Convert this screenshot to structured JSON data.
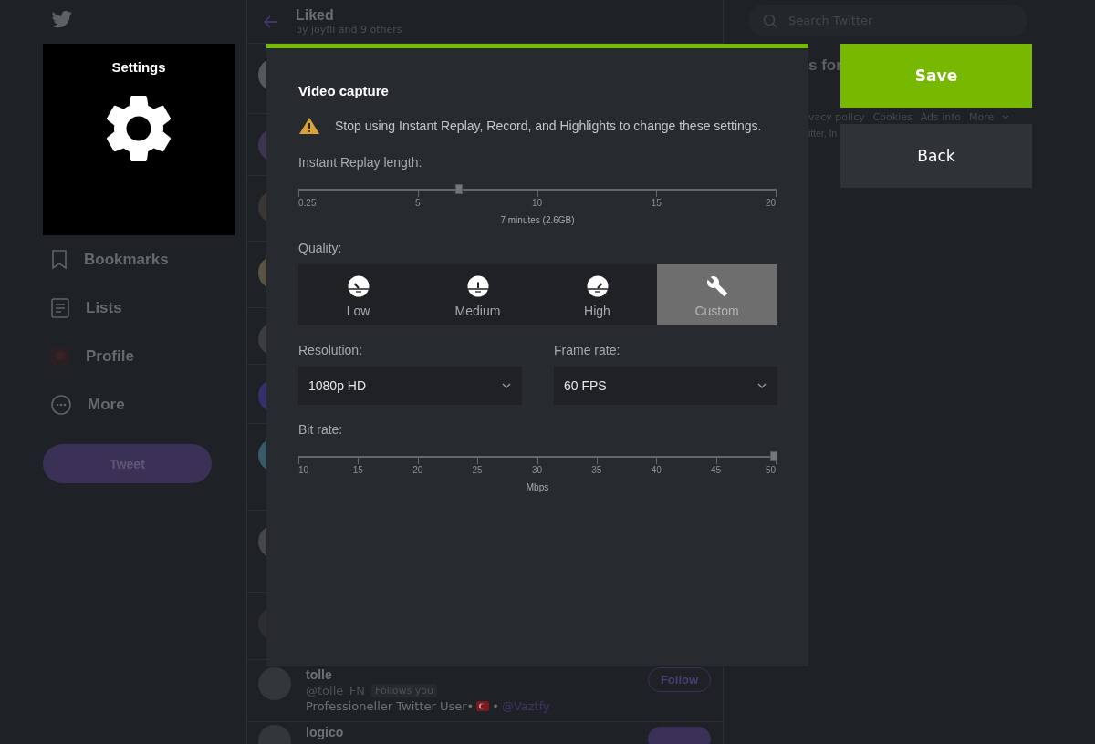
{
  "sidebar": {
    "items": [
      {
        "label": "Bookmarks",
        "kind": "bookmark"
      },
      {
        "label": "Lists",
        "kind": "list"
      },
      {
        "label": "Profile",
        "kind": "profile"
      },
      {
        "label": "More",
        "kind": "more"
      }
    ],
    "tweet_button": "Tweet"
  },
  "settings_tile": {
    "title": "Settings"
  },
  "timeline": {
    "title": "Liked",
    "subtitle": "by joyfll and 9 others",
    "users": [
      {
        "name": "tolle",
        "handle": "@tolle_FN",
        "badge": "Follows you",
        "bio": "Professioneller Twitter User•",
        "bio_after_flag": "•",
        "mention": "@Vaztfy",
        "button": "Follow",
        "following": false
      },
      {
        "name": "logico",
        "following": true
      }
    ]
  },
  "right": {
    "search": {
      "placeholder": "Search Twitter"
    },
    "heading": "s for",
    "footer_links": [
      "vacy policy",
      "Cookies",
      "Ads info",
      "More"
    ],
    "copyright": "itter, In"
  },
  "dialog": {
    "title": "Video capture",
    "warning": "Stop using Instant Replay, Record, and Highlights to change these settings.",
    "replay": {
      "label": "Instant Replay length:",
      "ticks": [
        "0.25",
        "5",
        "10",
        "15",
        "20"
      ],
      "level": 0.34,
      "reading": "7 minutes (2.6GB)"
    },
    "quality": {
      "label": "Quality:",
      "options": [
        {
          "label": "Low",
          "kind": "low",
          "selected": false
        },
        {
          "label": "Medium",
          "kind": "medium",
          "selected": false
        },
        {
          "label": "High",
          "kind": "high",
          "selected": false
        },
        {
          "label": "Custom",
          "kind": "custom",
          "selected": true
        }
      ]
    },
    "resolution": {
      "label": "Resolution:",
      "value": "1080p HD"
    },
    "frame_rate": {
      "label": "Frame rate:",
      "value": "60 FPS"
    },
    "bit_rate": {
      "label": "Bit rate:",
      "ticks": [
        "10",
        "15",
        "20",
        "25",
        "30",
        "35",
        "40",
        "45",
        "50"
      ],
      "level": 1,
      "unit": "Mbps"
    }
  },
  "actions": [
    {
      "label": "Save",
      "kind": "primary"
    },
    {
      "label": "Back",
      "kind": "secondary"
    }
  ]
}
